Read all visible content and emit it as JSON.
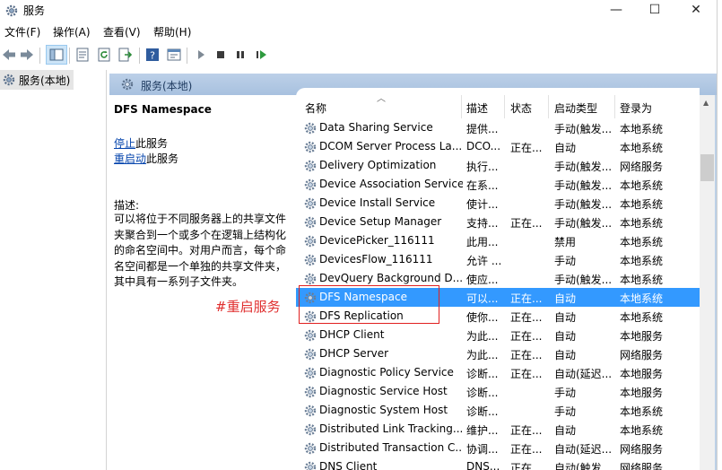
{
  "window": {
    "title": "服务",
    "minimize": "—",
    "maximize": "☐",
    "close": "✕"
  },
  "menu": [
    "文件(F)",
    "操作(A)",
    "查看(V)",
    "帮助(H)"
  ],
  "tree": {
    "label": "服务(本地)"
  },
  "main": {
    "title": "服务(本地)"
  },
  "details": {
    "service_name": "DFS Namespace",
    "stop_link": "停止",
    "stop_suffix": "此服务",
    "restart_link": "重启动",
    "restart_suffix": "此服务",
    "desc_label": "描述:",
    "desc_text": "可以将位于不同服务器上的共享文件夹聚合到一个或多个在逻辑上结构化的命名空间中。对用户而言，每个命名空间都是一个单独的共享文件夹，其中具有一系列子文件夹。",
    "annotation": "#重启服务"
  },
  "columns": {
    "name": "名称",
    "desc": "描述",
    "status": "状态",
    "startup": "启动类型",
    "logon": "登录为"
  },
  "rows": [
    {
      "name": "Data Sharing Service",
      "desc": "提供...",
      "status": "",
      "startup": "手动(触发...",
      "logon": "本地系统"
    },
    {
      "name": "DCOM Server Process La...",
      "desc": "DCO...",
      "status": "正在...",
      "startup": "自动",
      "logon": "本地系统"
    },
    {
      "name": "Delivery Optimization",
      "desc": "执行...",
      "status": "",
      "startup": "手动(触发...",
      "logon": "网络服务"
    },
    {
      "name": "Device Association Service",
      "desc": "在系...",
      "status": "",
      "startup": "手动(触发...",
      "logon": "本地系统"
    },
    {
      "name": "Device Install Service",
      "desc": "使计...",
      "status": "",
      "startup": "手动(触发...",
      "logon": "本地系统"
    },
    {
      "name": "Device Setup Manager",
      "desc": "支持...",
      "status": "正在...",
      "startup": "手动(触发...",
      "logon": "本地系统"
    },
    {
      "name": "DevicePicker_116111",
      "desc": "此用...",
      "status": "",
      "startup": "禁用",
      "logon": "本地系统"
    },
    {
      "name": "DevicesFlow_116111",
      "desc": "允许 ...",
      "status": "",
      "startup": "手动",
      "logon": "本地系统"
    },
    {
      "name": "DevQuery Background D...",
      "desc": "使应...",
      "status": "",
      "startup": "手动(触发...",
      "logon": "本地系统"
    },
    {
      "name": "DFS Namespace",
      "desc": "可以...",
      "status": "正在...",
      "startup": "自动",
      "logon": "本地系统"
    },
    {
      "name": "DFS Replication",
      "desc": "使你...",
      "status": "正在...",
      "startup": "自动",
      "logon": "本地系统"
    },
    {
      "name": "DHCP Client",
      "desc": "为此...",
      "status": "正在...",
      "startup": "自动",
      "logon": "本地服务"
    },
    {
      "name": "DHCP Server",
      "desc": "为此...",
      "status": "正在...",
      "startup": "自动",
      "logon": "网络服务"
    },
    {
      "name": "Diagnostic Policy Service",
      "desc": "诊断...",
      "status": "正在...",
      "startup": "自动(延迟...",
      "logon": "本地服务"
    },
    {
      "name": "Diagnostic Service Host",
      "desc": "诊断...",
      "status": "",
      "startup": "手动",
      "logon": "本地服务"
    },
    {
      "name": "Diagnostic System Host",
      "desc": "诊断...",
      "status": "",
      "startup": "手动",
      "logon": "本地系统"
    },
    {
      "name": "Distributed Link Tracking...",
      "desc": "维护...",
      "status": "正在...",
      "startup": "自动",
      "logon": "本地系统"
    },
    {
      "name": "Distributed Transaction C...",
      "desc": "协调...",
      "status": "正在...",
      "startup": "自动(延迟...",
      "logon": "网络服务"
    },
    {
      "name": "DNS Client",
      "desc": "DNS...",
      "status": "正在...",
      "startup": "自动(触发...",
      "logon": "网络服务"
    }
  ],
  "selected_row": "DFS Namespace",
  "colors": {
    "selection": "#3399ff",
    "header_band": "#b4cbe6",
    "annotation": "#e03030",
    "highlight_box": "#e02020"
  }
}
